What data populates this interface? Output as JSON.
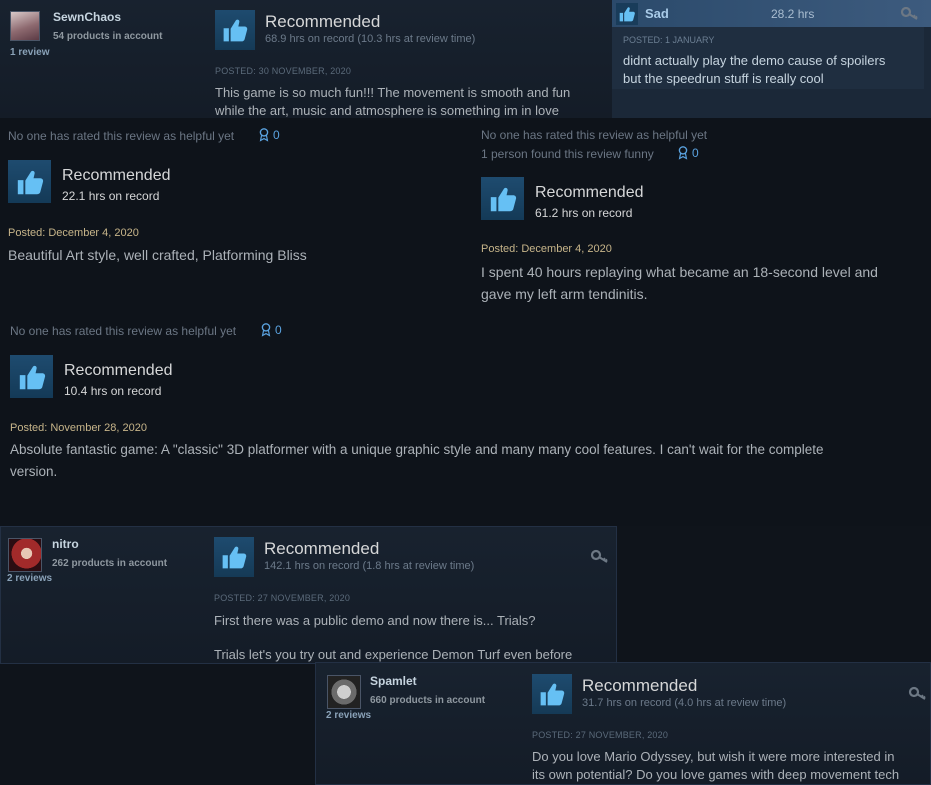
{
  "reviews_top": {
    "sewnchaos": {
      "username": "SewnChaos",
      "products": "54 products in account",
      "reviews": "1 review",
      "verdict": "Recommended",
      "hours": "68.9 hrs on record (10.3 hrs at review time)",
      "posted": "POSTED: 30 NOVEMBER, 2020",
      "body_line1": "This game is so much fun!!! The movement is smooth and fun",
      "body_line2": "while the art, music and atmosphere is something im in love"
    },
    "sad": {
      "username": "Sad",
      "hours": "28.2 hrs",
      "posted": "POSTED: 1 JANUARY",
      "body_line1": "didnt actually play the demo cause of spoilers",
      "body_line2": "but the speedrun stuff is really cool"
    }
  },
  "reviews_mid": [
    {
      "helpful": "No one has rated this review as helpful yet",
      "award_count": "0",
      "verdict": "Recommended",
      "hours": "22.1 hrs on record",
      "posted": "Posted: December 4, 2020",
      "body": "Beautiful Art style, well crafted, Platforming Bliss"
    },
    {
      "helpful": "No one has rated this review as helpful yet",
      "funny": "1 person found this review funny",
      "award_count": "0",
      "verdict": "Recommended",
      "hours": "61.2 hrs on record",
      "posted": "Posted: December 4, 2020",
      "body_line1": "I spent 40 hours replaying what became an 18-second level and",
      "body_line2": "gave my left arm tendinitis."
    },
    {
      "helpful": "No one has rated this review as helpful yet",
      "award_count": "0",
      "verdict": "Recommended",
      "hours": "10.4 hrs on record",
      "posted": "Posted: November 28, 2020",
      "body_line1": "Absolute fantastic game: A \"classic\" 3D platformer with a unique graphic style and many many cool features. I can't wait for the complete",
      "body_line2": "version."
    }
  ],
  "reviews_bottom": {
    "nitro": {
      "username": "nitro",
      "products": "262 products in account",
      "reviews": "2 reviews",
      "verdict": "Recommended",
      "hours": "142.1 hrs on record (1.8 hrs at review time)",
      "posted": "POSTED: 27 NOVEMBER, 2020",
      "body_line1": "First there was a public demo and now there is... Trials?",
      "body_line2": "Trials let's you try out and experience Demon Turf even before"
    },
    "spamlet": {
      "username": "Spamlet",
      "products": "660 products in account",
      "reviews": "2 reviews",
      "verdict": "Recommended",
      "hours": "31.7 hrs on record (4.0 hrs at review time)",
      "posted": "POSTED: 27 NOVEMBER, 2020",
      "body_line1": "Do you love Mario Odyssey, but wish it were more interested in",
      "body_line2": "its own potential? Do you love games with deep movement tech"
    }
  },
  "colors": {
    "accent_blue": "#5aa2df",
    "posted_gold": "#c7b58a"
  },
  "icons": {
    "thumbs_up": "thumbs-up-icon",
    "award": "award-icon",
    "key": "key-icon"
  }
}
